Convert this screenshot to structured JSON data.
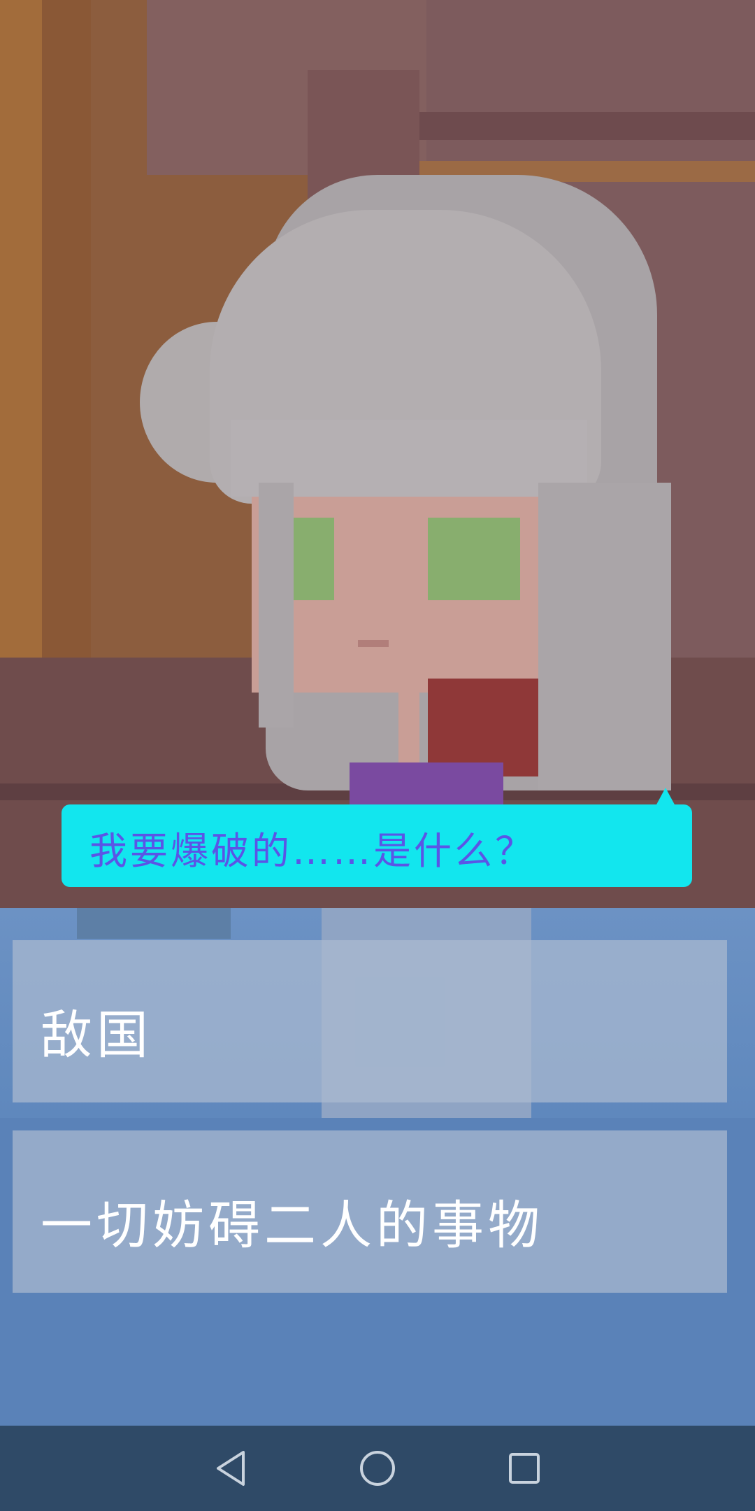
{
  "dialogue": {
    "text": "我要爆破的……是什么？"
  },
  "choices": [
    {
      "label": "敌国"
    },
    {
      "label": "一切妨碍二人的事物"
    }
  ],
  "navbar": {
    "icons": [
      "back-icon",
      "home-icon",
      "recents-icon"
    ]
  },
  "colors": {
    "speech_bubble": "#12e6ee",
    "speech_text": "#5a55e6",
    "choice_bg": "#aabad0",
    "navbar": "#2f4a67"
  }
}
